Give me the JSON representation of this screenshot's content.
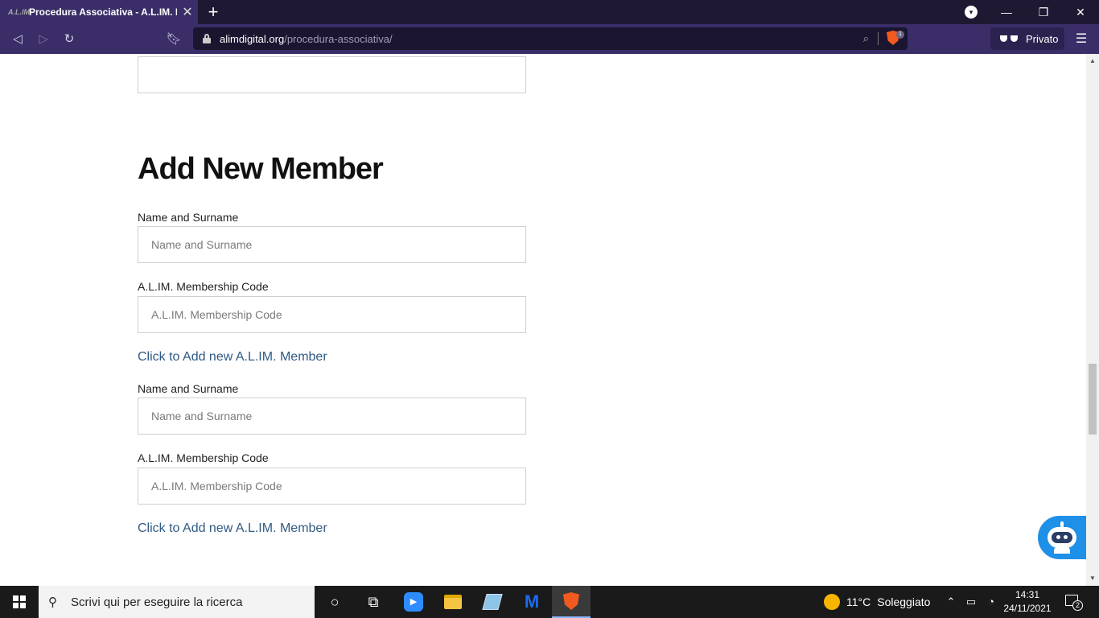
{
  "browser": {
    "tab_title": "Procedura Associativa - A.L.IM. Di",
    "favicon_text": "A.L.IM.",
    "new_tab_label": "+",
    "url_domain": "alimdigital.org",
    "url_path": "/procedura-associativa/",
    "shield_badge": "1",
    "private_label": "Privato"
  },
  "page": {
    "heading": "Add New Member",
    "members": [
      {
        "name_label": "Name and Surname",
        "name_placeholder": "Name and Surname",
        "code_label": "A.L.IM. Membership Code",
        "code_placeholder": "A.L.IM. Membership Code",
        "add_link": "Click to Add new A.L.IM. Member"
      },
      {
        "name_label": "Name and Surname",
        "name_placeholder": "Name and Surname",
        "code_label": "A.L.IM. Membership Code",
        "code_placeholder": "A.L.IM. Membership Code",
        "add_link": "Click to Add new A.L.IM. Member"
      }
    ]
  },
  "taskbar": {
    "search_placeholder": "Scrivi qui per eseguire la ricerca",
    "weather_temp": "11°C",
    "weather_desc": "Soleggiato",
    "time": "14:31",
    "date": "24/11/2021",
    "notification_count": "2"
  },
  "colors": {
    "browser_chrome": "#3b2e68",
    "link": "#305a84",
    "chat_widget": "#1e90e8"
  }
}
